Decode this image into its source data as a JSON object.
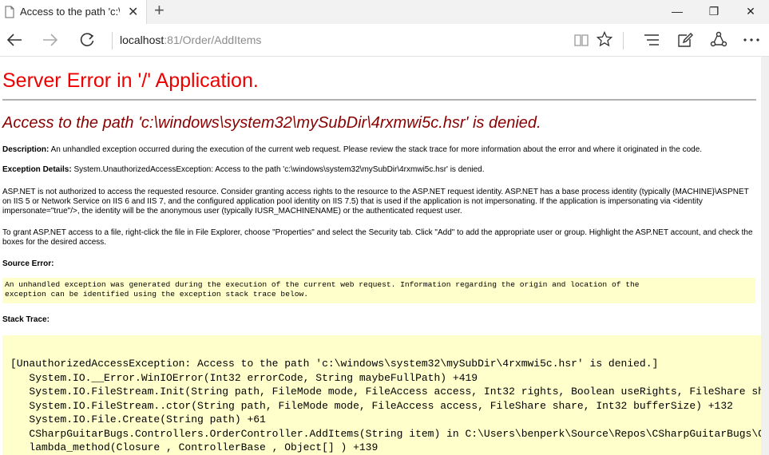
{
  "browser": {
    "tab_title": "Access to the path 'c:\\wi",
    "tab_close": "✕",
    "new_tab": "+",
    "url_host": "localhost",
    "url_rest": ":81/Order/AddItems",
    "window_controls": {
      "minimize": "—",
      "maximize": "❐",
      "close": "✕"
    }
  },
  "page": {
    "title": "Server Error in '/' Application.",
    "error_heading": "Access to the path 'c:\\windows\\system32\\mySubDir\\4rxmwi5c.hsr' is denied.",
    "description_label": "Description:",
    "description_text": " An unhandled exception occurred during the execution of the current web request. Please review the stack trace for more information about the error and where it originated in the code.",
    "exception_label": "Exception Details:",
    "exception_text": " System.UnauthorizedAccessException: Access to the path 'c:\\windows\\system32\\mySubDir\\4rxmwi5c.hsr' is denied.",
    "aspnet_paragraph": "ASP.NET is not authorized to access the requested resource. Consider granting access rights to the resource to the ASP.NET request identity. ASP.NET has a base process identity (typically {MACHINE}\\ASPNET on IIS 5 or Network Service on IIS 6 and IIS 7, and the configured application pool identity on IIS 7.5) that is used if the application is not impersonating. If the application is impersonating via <identity impersonate=\"true\"/>, the identity will be the anonymous user (typically IUSR_MACHINENAME) or the authenticated request user.",
    "grant_paragraph": "To grant ASP.NET access to a file, right-click the file in File Explorer, choose \"Properties\" and select the Security tab. Click \"Add\" to add the appropriate user or group. Highlight the ASP.NET account, and check the boxes for the desired access.",
    "source_error_label": "Source Error:",
    "source_error_text": "An unhandled exception was generated during the execution of the current web request. Information regarding the origin and location of the\nexception can be identified using the exception stack trace below.",
    "stack_trace_label": "Stack Trace:",
    "stack_trace_text": "[UnauthorizedAccessException: Access to the path 'c:\\windows\\system32\\mySubDir\\4rxmwi5c.hsr' is denied.]\n   System.IO.__Error.WinIOError(Int32 errorCode, String maybeFullPath) +419\n   System.IO.FileStream.Init(String path, FileMode mode, FileAccess access, Int32 rights, Boolean useRights, FileShare share\n   System.IO.FileStream..ctor(String path, FileMode mode, FileAccess access, FileShare share, Int32 bufferSize) +132\n   System.IO.File.Create(String path) +61\n   CSharpGuitarBugs.Controllers.OrderController.AddItems(String item) in C:\\Users\\benperk\\Source\\Repos\\CSharpGuitarBugs\\CSha\n   lambda_method(Closure , ControllerBase , Object[] ) +139"
  }
}
